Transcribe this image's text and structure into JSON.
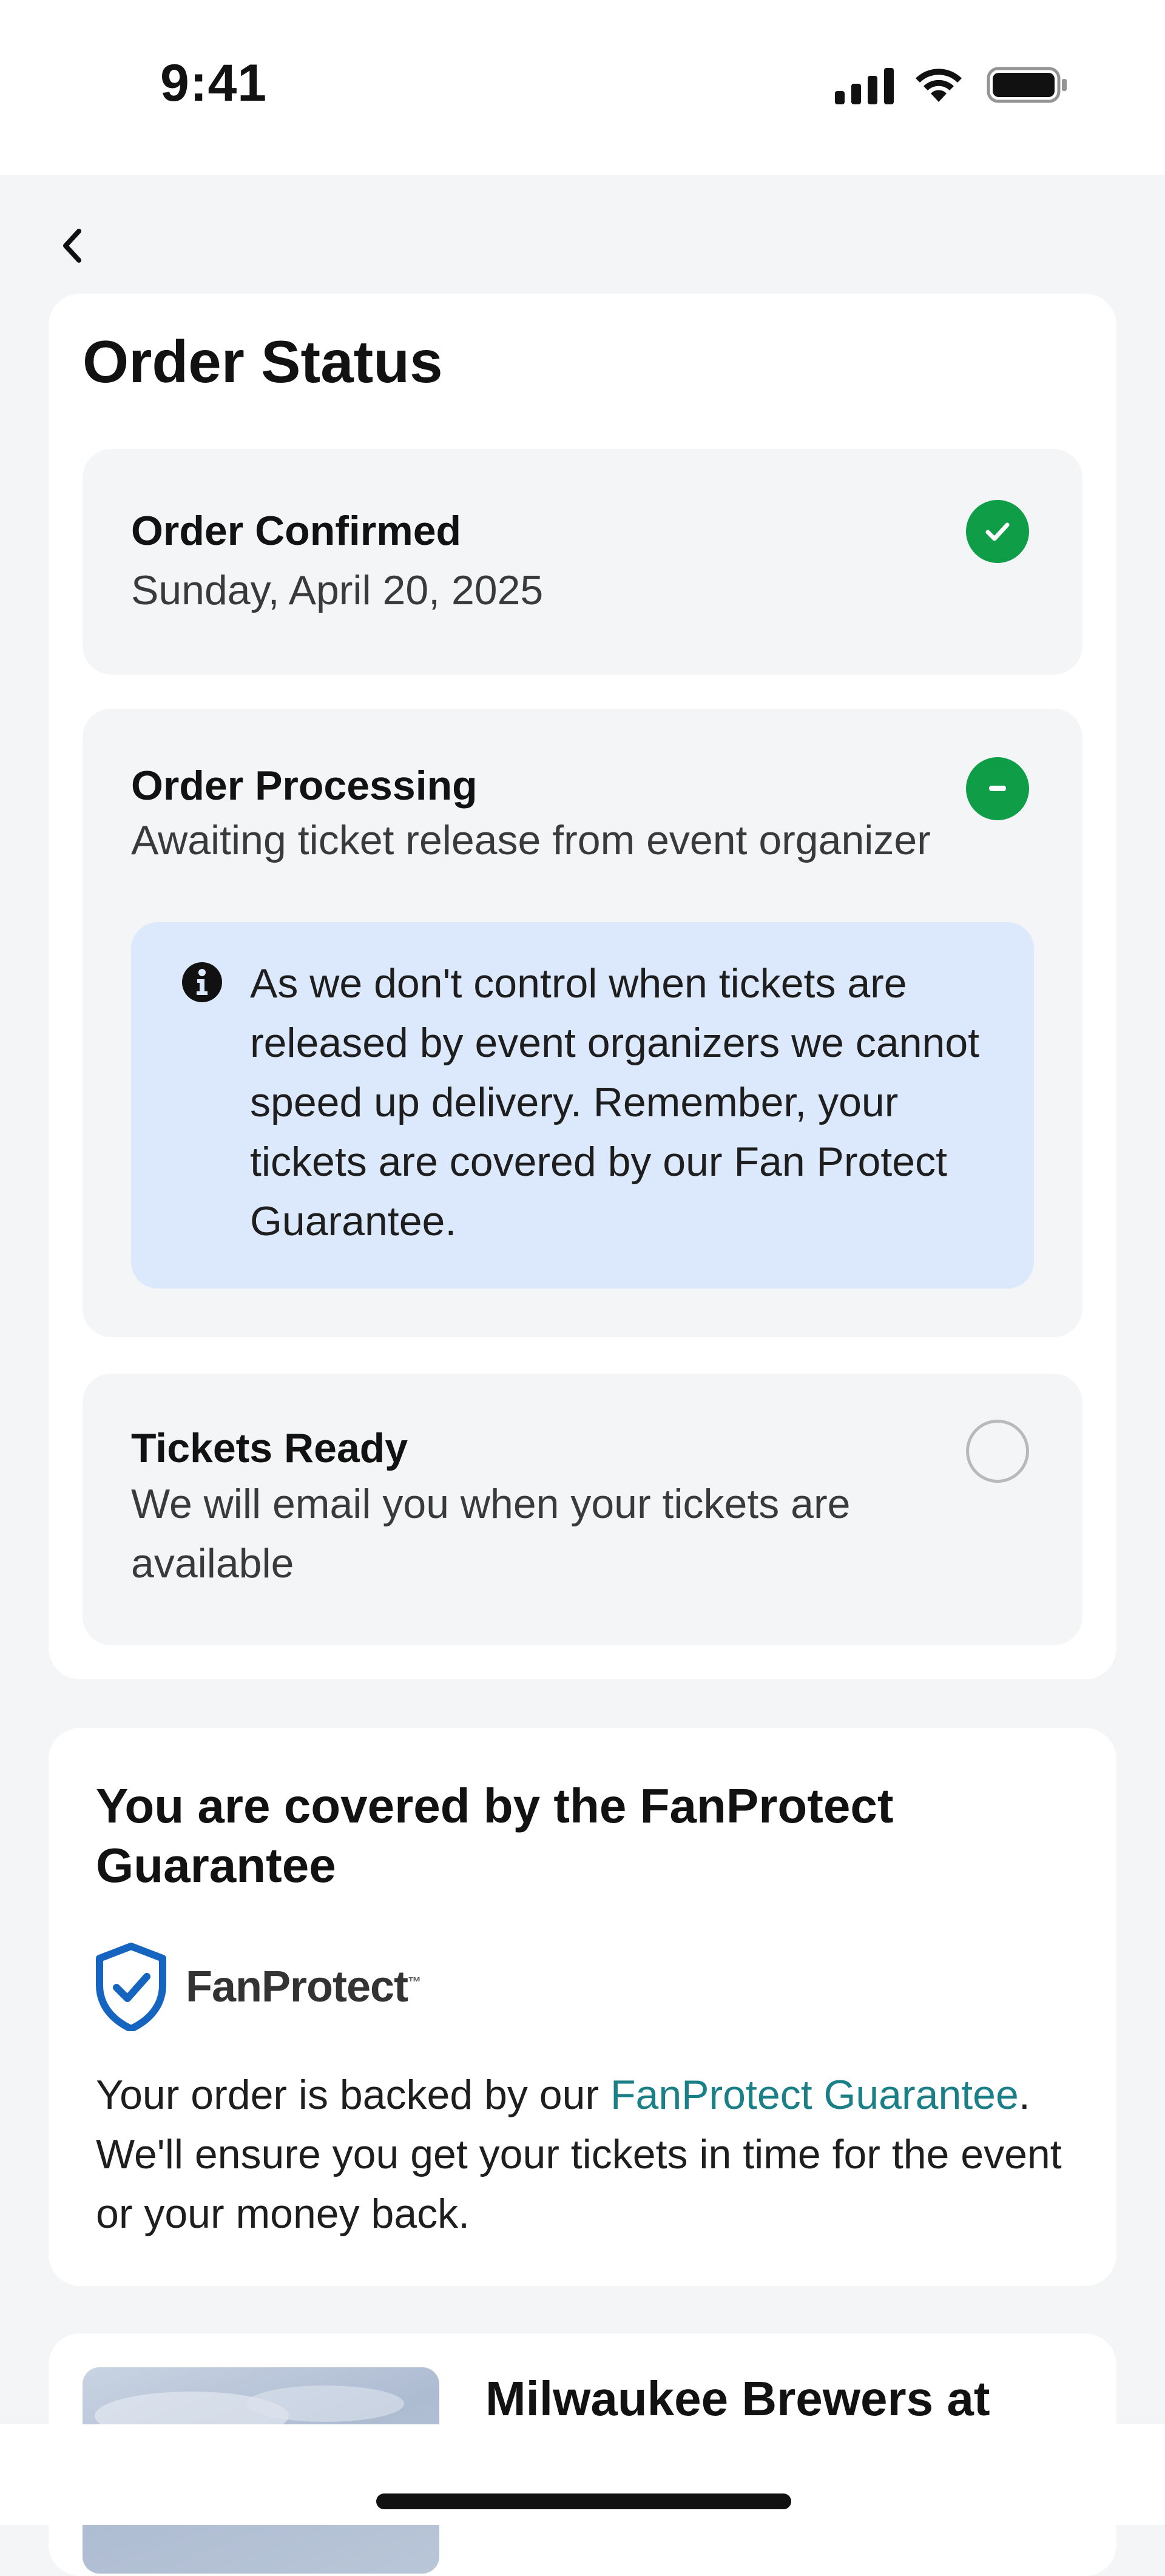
{
  "status_bar": {
    "time": "9:41"
  },
  "order_status": {
    "title": "Order Status",
    "steps": [
      {
        "title": "Order Confirmed",
        "subtitle": "Sunday, April 20, 2025",
        "state": "done",
        "icon": "check-icon"
      },
      {
        "title": "Order Processing",
        "subtitle": "Awaiting ticket release from event organizer",
        "state": "in-progress",
        "icon": "minus-icon",
        "info": "As we don't control when tickets are released by event organizers we cannot speed up delivery. Remember, your tickets are covered by our Fan Protect Guarantee."
      },
      {
        "title": "Tickets Ready",
        "subtitle": "We will email you when your tickets are available",
        "state": "pending",
        "icon": "empty-circle-icon"
      }
    ]
  },
  "guarantee": {
    "title": "You are covered by the FanProtect Guarantee",
    "logo_text": "FanProtect",
    "logo_tm": "™",
    "text_before": "Your order is backed by our ",
    "link_text": "FanProtect Guarantee",
    "text_after": ". We'll ensure you get your tickets in time for the event or your money back."
  },
  "event": {
    "title": "Milwaukee Brewers at"
  },
  "colors": {
    "success": "#0f9d48",
    "info_bg": "#dce9fc",
    "link": "#1a7f86",
    "shield": "#1565c0"
  }
}
